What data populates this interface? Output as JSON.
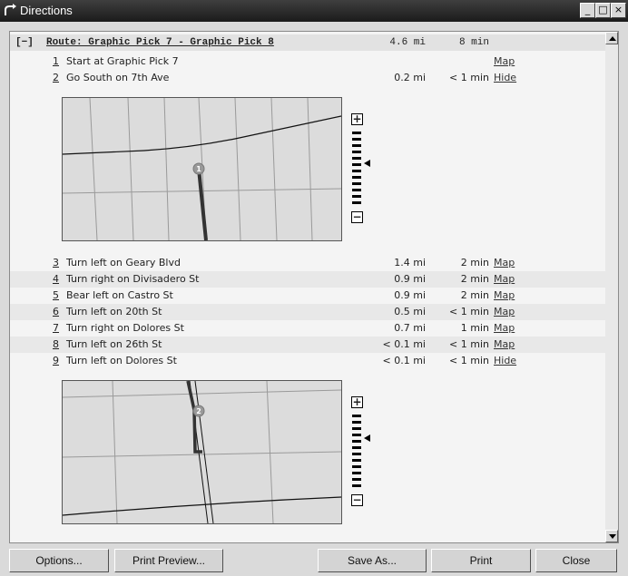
{
  "window": {
    "title": "Directions"
  },
  "route": {
    "toggle": "[−]",
    "title": "Route: Graphic Pick 7 - Graphic Pick 8",
    "distance": "4.6 mi",
    "time": "8 min"
  },
  "steps": [
    {
      "num": "1",
      "desc": "Start at Graphic Pick 7",
      "dist": "",
      "time": "",
      "link": "Map"
    },
    {
      "num": "2",
      "desc": "Go South on 7th Ave",
      "dist": "0.2 mi",
      "time": "< 1 min",
      "link": "Hide"
    },
    {
      "num": "3",
      "desc": "Turn left on Geary Blvd",
      "dist": "1.4 mi",
      "time": "2 min",
      "link": "Map"
    },
    {
      "num": "4",
      "desc": "Turn right on Divisadero St",
      "dist": "0.9 mi",
      "time": "2 min",
      "link": "Map"
    },
    {
      "num": "5",
      "desc": "Bear left on Castro St",
      "dist": "0.9 mi",
      "time": "2 min",
      "link": "Map"
    },
    {
      "num": "6",
      "desc": "Turn left on 20th St",
      "dist": "0.5 mi",
      "time": "< 1 min",
      "link": "Map"
    },
    {
      "num": "7",
      "desc": "Turn right on Dolores St",
      "dist": "0.7 mi",
      "time": "1 min",
      "link": "Map"
    },
    {
      "num": "8",
      "desc": "Turn left on 26th St",
      "dist": "< 0.1 mi",
      "time": "< 1 min",
      "link": "Map"
    },
    {
      "num": "9",
      "desc": "Turn left on Dolores St",
      "dist": "< 0.1 mi",
      "time": "< 1 min",
      "link": "Hide"
    }
  ],
  "maps": [
    {
      "marker": "1"
    },
    {
      "marker": "2"
    }
  ],
  "buttons": {
    "options": "Options...",
    "print_preview": "Print Preview...",
    "save_as": "Save As...",
    "print": "Print",
    "close": "Close"
  },
  "icons": {
    "app": "directions-icon",
    "zoom_in": "zoom-in-icon",
    "zoom_out": "zoom-out-icon"
  }
}
